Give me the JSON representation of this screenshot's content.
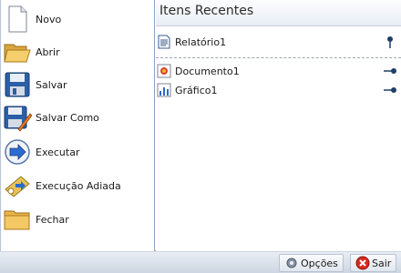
{
  "menu": {
    "commands": [
      {
        "label": "Novo",
        "icon": "new-document-icon"
      },
      {
        "label": "Abrir",
        "icon": "open-folder-icon"
      },
      {
        "label": "Salvar",
        "icon": "save-floppy-icon"
      },
      {
        "label": "Salvar Como",
        "icon": "save-as-icon"
      },
      {
        "label": "Executar",
        "icon": "run-arrow-icon"
      },
      {
        "label": "Execução Adiada",
        "icon": "deferred-run-icon"
      },
      {
        "label": "Fechar",
        "icon": "close-folder-icon"
      }
    ]
  },
  "recent": {
    "title": "Itens Recentes",
    "items": [
      {
        "name": "Relatório1",
        "icon": "report-document-icon",
        "pinned": true
      },
      {
        "name": "Documento1",
        "icon": "document-icon",
        "pinned": false
      },
      {
        "name": "Gráfico1",
        "icon": "chart-document-icon",
        "pinned": false
      }
    ]
  },
  "footer": {
    "options_label": "Opções",
    "exit_label": "Sair"
  },
  "colors": {
    "border": "#8ea3bf",
    "header_bg": "#e8edf4",
    "accent_blue": "#2c6bd1",
    "exit_red": "#d62a1e"
  }
}
